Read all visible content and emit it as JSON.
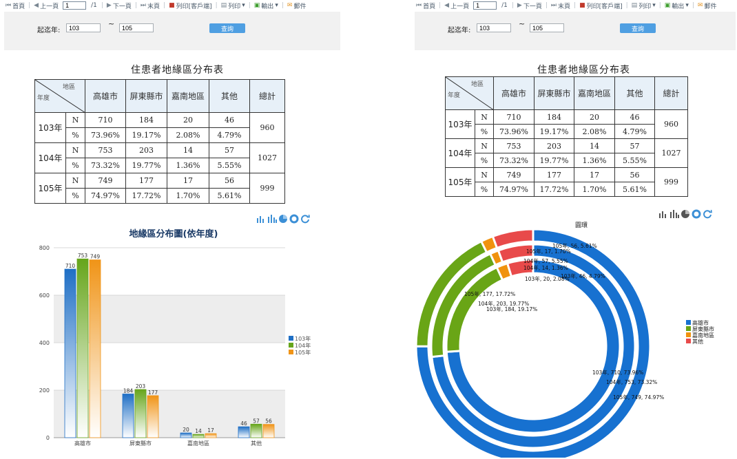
{
  "toolbar": {
    "first": "首頁",
    "prev": "上一頁",
    "page": "1",
    "total": "/1",
    "next": "下一頁",
    "last": "末頁",
    "print_client": "列印[客戶端]",
    "print": "列印",
    "export": "輸出",
    "mail": "郵件"
  },
  "filter": {
    "label": "起迄年:",
    "from_value": "103",
    "tilde": "~",
    "to_value": "105",
    "query": "查詢"
  },
  "report": {
    "title": "住患者地緣區分布表",
    "corner_region": "地區",
    "corner_year": "年度",
    "columns": [
      "高雄市",
      "屏東縣市",
      "嘉南地區",
      "其他",
      "總計"
    ],
    "rows": [
      {
        "year": "103年",
        "n": [
          "710",
          "184",
          "20",
          "46"
        ],
        "pct": [
          "73.96%",
          "19.17%",
          "2.08%",
          "4.79%"
        ],
        "total": "960"
      },
      {
        "year": "104年",
        "n": [
          "753",
          "203",
          "14",
          "57"
        ],
        "pct": [
          "73.32%",
          "19.77%",
          "1.36%",
          "5.55%"
        ],
        "total": "1027"
      },
      {
        "year": "105年",
        "n": [
          "749",
          "177",
          "17",
          "56"
        ],
        "pct": [
          "74.97%",
          "17.72%",
          "1.70%",
          "5.61%"
        ],
        "total": "999"
      }
    ],
    "n_label": "N",
    "pct_label": "%"
  },
  "chart_tools": [
    "bar-chart-icon",
    "stacked-bar-icon",
    "pie-chart-icon",
    "donut-chart-icon",
    "refresh-icon"
  ],
  "colors": {
    "series": [
      "#1f6fc5",
      "#66a51b",
      "#f09417"
    ],
    "donut": [
      "#1771d0",
      "#69a516",
      "#f0920e",
      "#e84a4a"
    ]
  },
  "chart_data": [
    {
      "type": "bar",
      "title": "地緣區分布圖(依年度)",
      "categories": [
        "高雄市",
        "屏東縣市",
        "嘉南地區",
        "其他"
      ],
      "series": [
        {
          "name": "103年",
          "values": [
            710,
            184,
            20,
            46
          ]
        },
        {
          "name": "104年",
          "values": [
            753,
            203,
            14,
            57
          ]
        },
        {
          "name": "105年",
          "values": [
            749,
            177,
            17,
            56
          ]
        }
      ],
      "ylim": [
        0,
        800
      ],
      "yticks": [
        0,
        200,
        400,
        600,
        800
      ],
      "legend": "right",
      "grid": true
    },
    {
      "type": "pie",
      "title": "圓環",
      "categories": [
        "高雄市",
        "屏東縣市",
        "嘉南地區",
        "其他"
      ],
      "rings": [
        {
          "name": "103年",
          "values": [
            710,
            184,
            20,
            46
          ],
          "labels": [
            "103年, 710, 73.96%",
            "103年, 184, 19.17%",
            "103年, 20, 2.08%",
            "103年, 46, 4.79%"
          ]
        },
        {
          "name": "104年",
          "values": [
            753,
            203,
            14,
            57
          ],
          "labels": [
            "104年, 753, 73.32%",
            "104年, 203, 19.77%",
            "104年, 14, 1.36%",
            "104年, 57, 5.55%"
          ]
        },
        {
          "name": "105年",
          "values": [
            749,
            177,
            17,
            56
          ],
          "labels": [
            "105年, 749, 74.97%",
            "105年, 177, 17.72%",
            "105年, 17, 1.70%",
            "105年, 56, 5.61%"
          ]
        }
      ],
      "legend": "right"
    }
  ]
}
